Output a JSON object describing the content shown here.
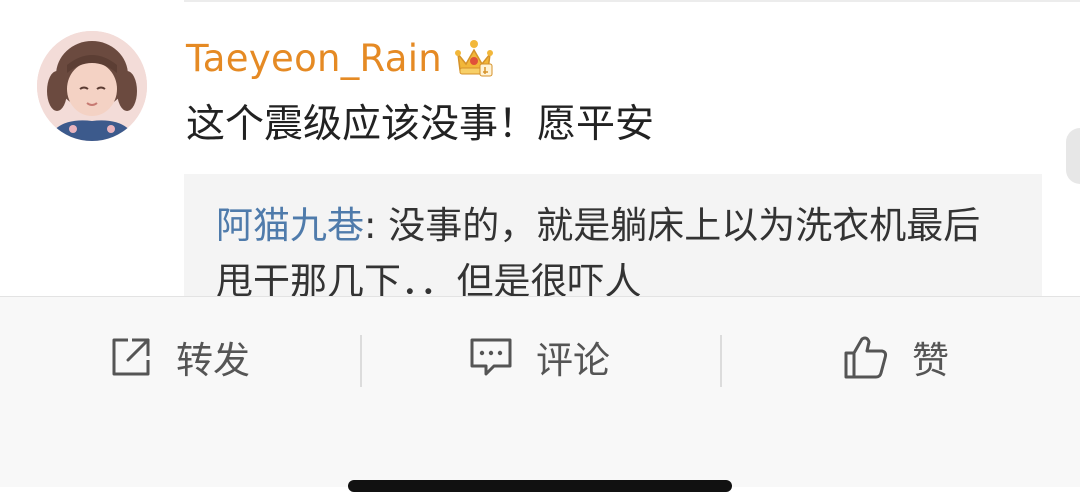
{
  "comment": {
    "username": "Taeyeon_Rain",
    "badge_icon": "crown-icon",
    "text": "这个震级应该没事！愿平安"
  },
  "reply": {
    "author": "阿猫九巷",
    "separator": ": ",
    "text": "没事的，就是躺床上以为洗衣机最后甩干那几下．．但是很吓人"
  },
  "actions": [
    {
      "icon": "share-icon",
      "label": "转发"
    },
    {
      "icon": "comment-icon",
      "label": "评论"
    },
    {
      "icon": "thumbs-up-icon",
      "label": "赞"
    }
  ],
  "colors": {
    "username": "#e58a24",
    "reply_author": "#4f7bab",
    "action_text": "#555555"
  }
}
